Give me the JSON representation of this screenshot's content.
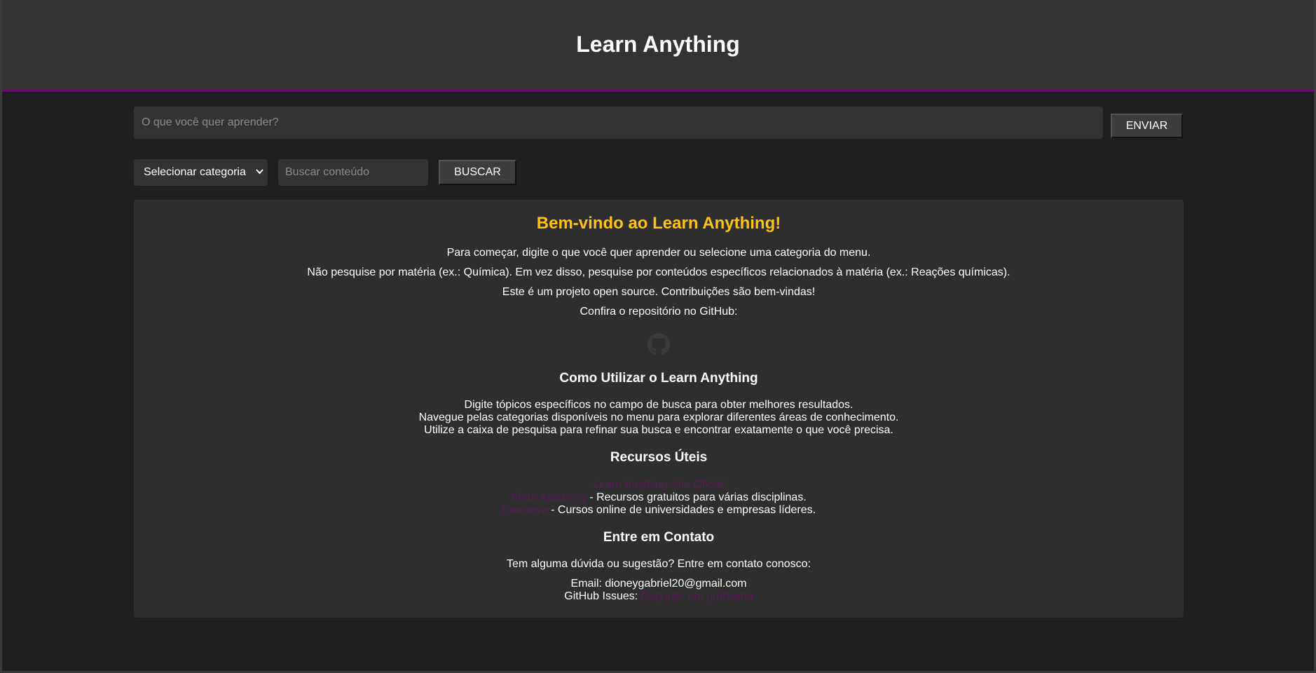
{
  "header": {
    "title": "Learn Anything"
  },
  "ask": {
    "placeholder": "O que você quer aprender?",
    "send_label": "ENVIAR"
  },
  "filter": {
    "category_selected": "Selecionar categoria",
    "search_placeholder": "Buscar conteúdo",
    "search_label": "BUSCAR"
  },
  "welcome": {
    "title": "Bem-vindo ao Learn Anything!",
    "lines": [
      "Para começar, digite o que você quer aprender ou selecione uma categoria do menu.",
      "Não pesquise por matéria (ex.: Química). Em vez disso, pesquise por conteúdos específicos relacionados à matéria (ex.: Reações químicas).",
      "Este é um projeto open source. Contribuições são bem-vindas!",
      "Confira o repositório no GitHub:"
    ]
  },
  "usage": {
    "title": "Como Utilizar o Learn Anything",
    "lines": [
      "Digite tópicos específicos no campo de busca para obter melhores resultados.",
      "Navegue pelas categorias disponíveis no menu para explorar diferentes áreas de conhecimento.",
      "Utilize a caixa de pesquisa para refinar sua busca e encontrar exatamente o que você precisa."
    ]
  },
  "resources": {
    "title": "Recursos Úteis",
    "items": [
      {
        "link": "Learn Anything Site Oficial",
        "desc": ""
      },
      {
        "link": "Khan Academy",
        "desc": " - Recursos gratuitos para várias disciplinas."
      },
      {
        "link": "Coursera",
        "desc": " - Cursos online de universidades e empresas líderes."
      }
    ]
  },
  "contact": {
    "title": "Entre em Contato",
    "intro": "Tem alguma dúvida ou sugestão? Entre em contato conosco:",
    "email": "Email: dioneygabriel20@gmail.com",
    "issues_label": "GitHub Issues: ",
    "issues_link": "Reportar um problema"
  },
  "colors": {
    "accent_yellow": "#ffc20e",
    "header_border": "#6a0a6a",
    "link": "#5a1a5a"
  }
}
